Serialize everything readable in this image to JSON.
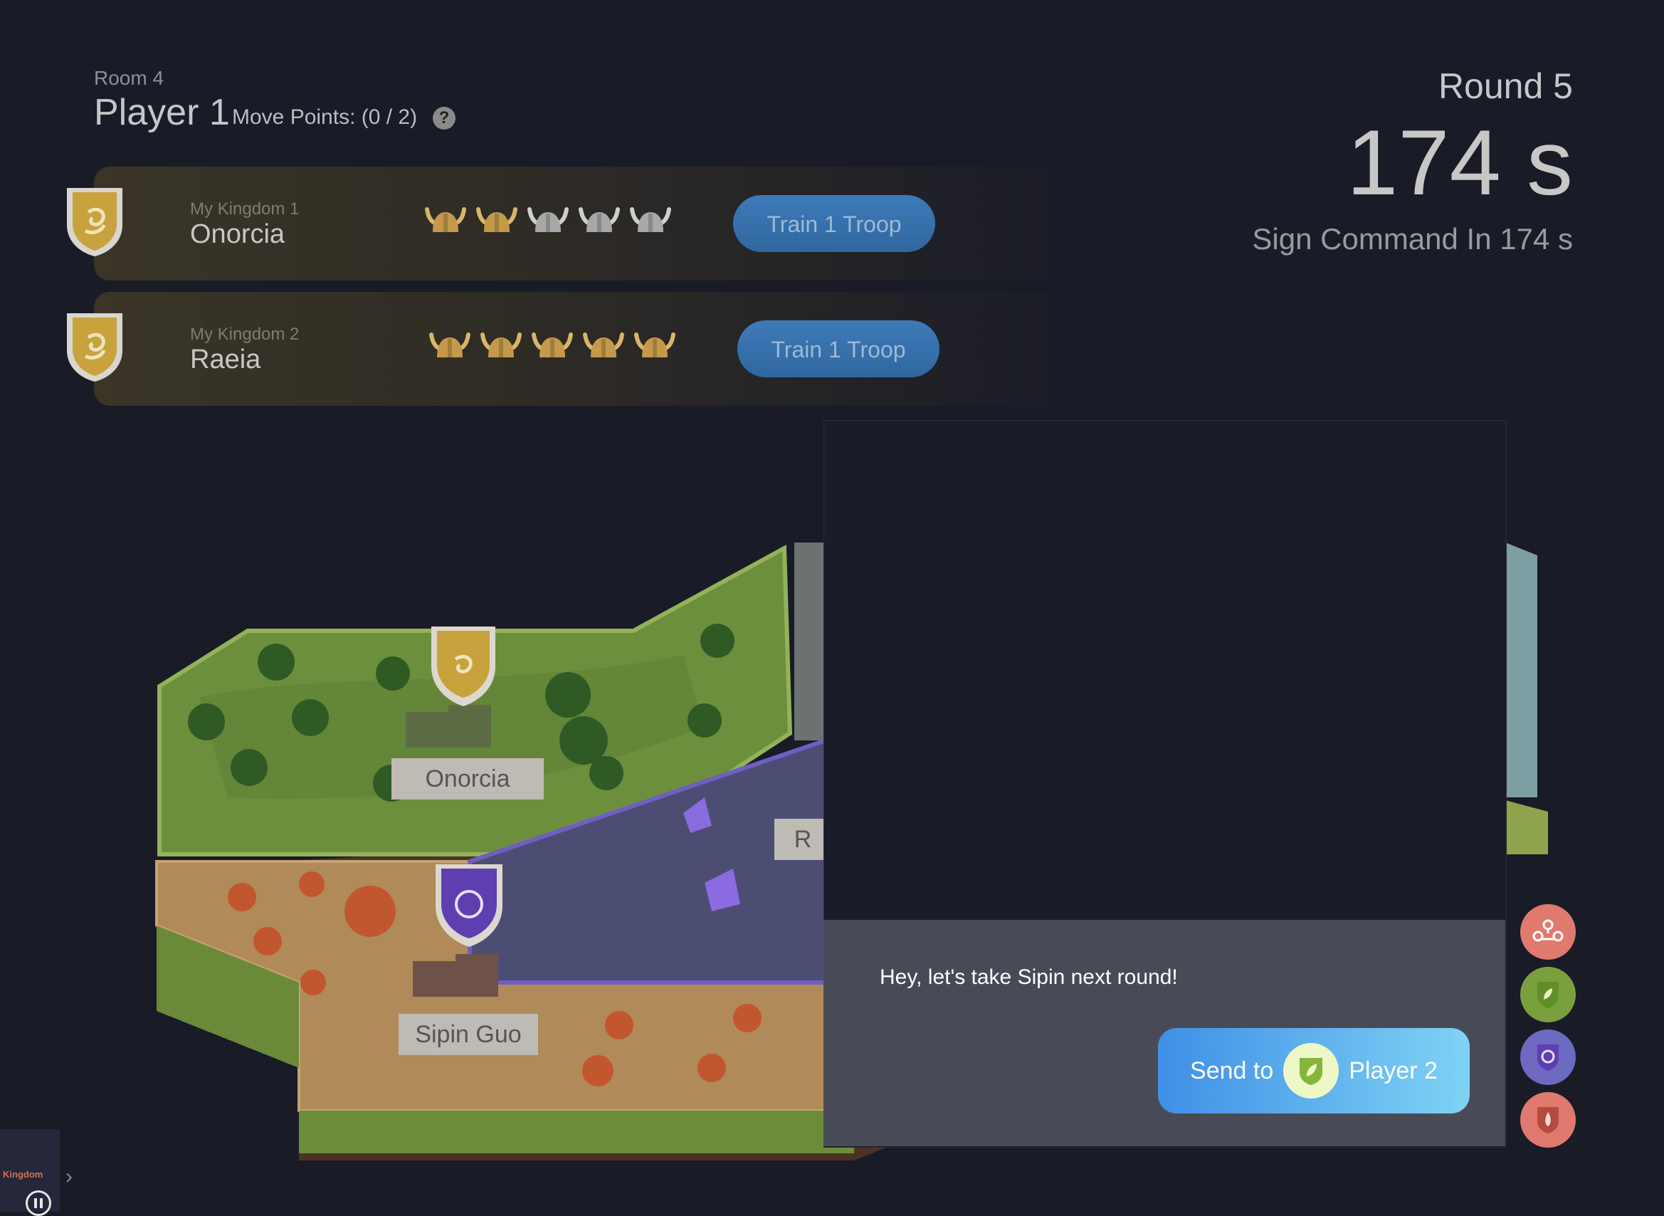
{
  "header": {
    "room": "Room 4",
    "player": "Player 1",
    "move_points": "Move Points: (0 / 2)",
    "help_icon": "?"
  },
  "round": {
    "label": "Round 5",
    "timer": "174 s",
    "sign_command": "Sign Command In 174 s"
  },
  "kingdoms": [
    {
      "subtitle": "My Kingdom 1",
      "name": "Onorcia",
      "troops_gold": 2,
      "troops_total": 5,
      "button": "Train 1 Troop"
    },
    {
      "subtitle": "My Kingdom 2",
      "name": "Raeia",
      "troops_gold": 5,
      "troops_total": 5,
      "button": "Train 1 Troop"
    }
  ],
  "map": {
    "labels": [
      "Onorcia",
      "Sipin Guo",
      "R"
    ]
  },
  "chat": {
    "message": "Hey, let's take Sipin next round!",
    "send_label": "Send to",
    "send_target": "Player 2"
  },
  "sidebar": {
    "buttons": [
      "team-icon",
      "leaf-shield-icon",
      "swirl-shield-icon",
      "flame-shield-icon"
    ]
  },
  "colors": {
    "gold": "#c7a23d",
    "purple": "#5e3fb0",
    "green_player": "#7aa03e",
    "red_player": "#b54a3e",
    "send_gradient_start": "#3f8fe6",
    "send_gradient_end": "#7fd3f4"
  },
  "logo": {
    "text": "Kingdom"
  }
}
